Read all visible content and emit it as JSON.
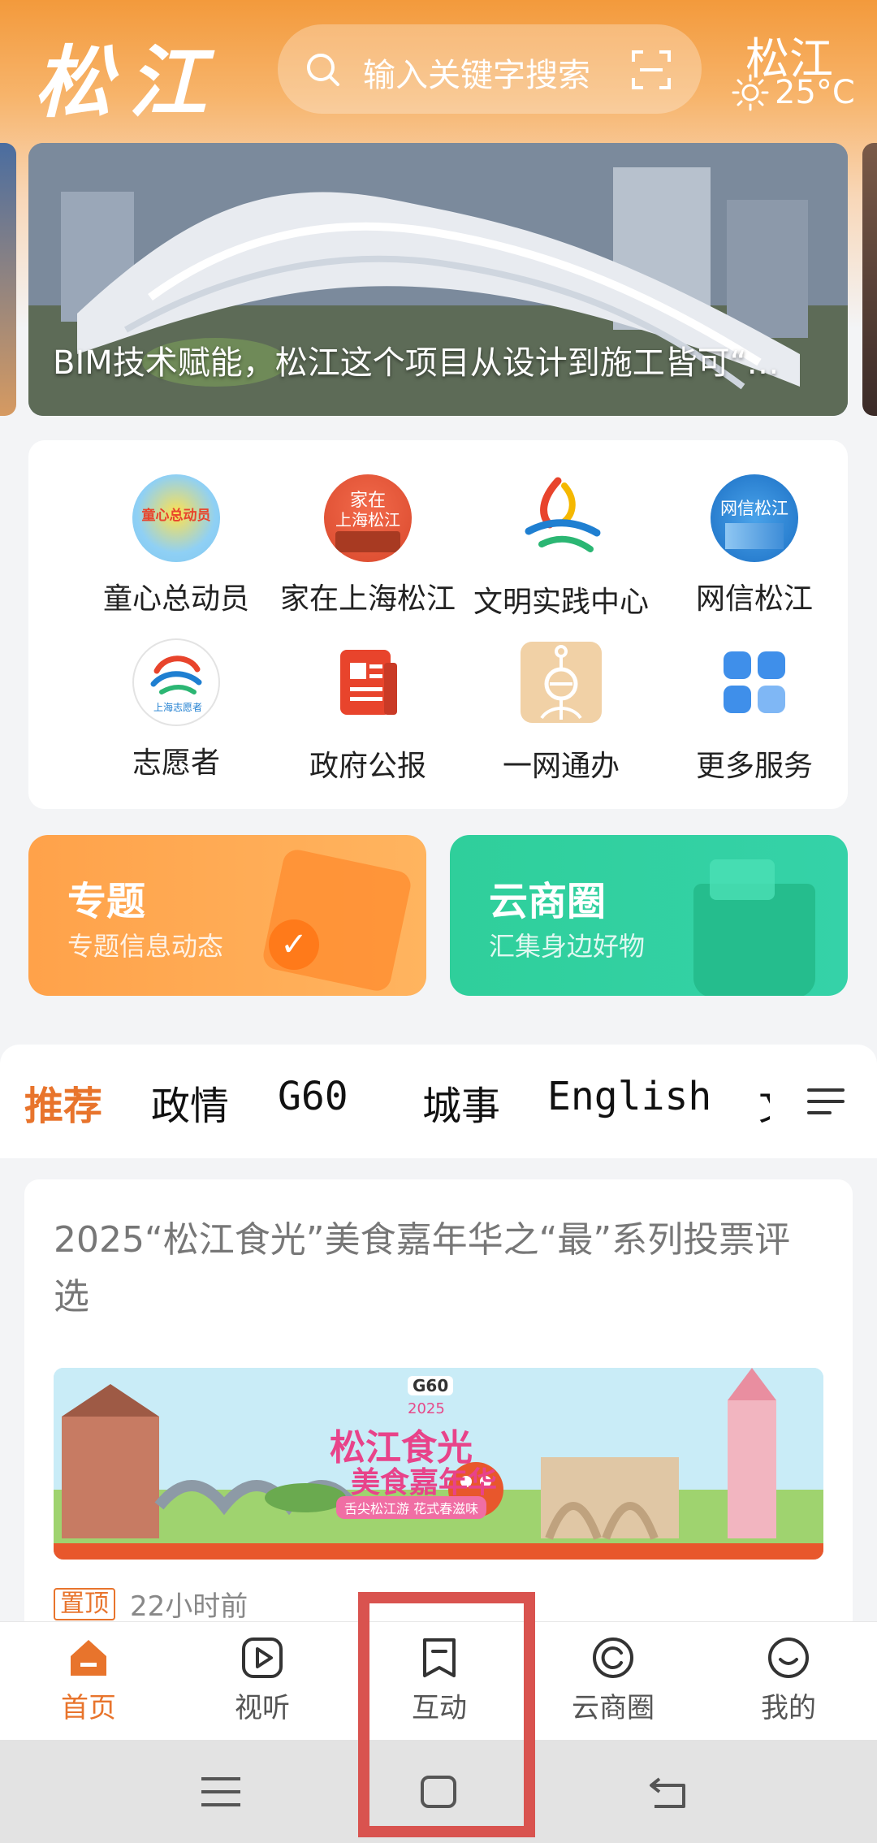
{
  "header": {
    "logo_text": "松江",
    "search_placeholder": "输入关键字搜索",
    "city": "松江",
    "temperature": "25°C"
  },
  "banner": {
    "caption": "BIM技术赋能，松江这个项目从设计到施工皆可“…"
  },
  "services": [
    {
      "label": "童心总动员",
      "icon": "kids-badge-icon"
    },
    {
      "label": "家在上海松江",
      "icon": "home-songjiang-icon"
    },
    {
      "label": "文明实践中心",
      "icon": "civilization-center-icon"
    },
    {
      "label": "网信松江",
      "icon": "net-info-icon"
    },
    {
      "label": "志愿者",
      "icon": "volunteer-icon"
    },
    {
      "label": "政府公报",
      "icon": "gazette-icon"
    },
    {
      "label": "一网通办",
      "icon": "one-network-icon"
    },
    {
      "label": "更多服务",
      "icon": "more-grid-icon"
    }
  ],
  "service_icon_text": {
    "kids": "童心总动员",
    "home_line1": "家在",
    "home_line2": "上海松江",
    "netinfo": "网信松江",
    "volunteer": "上海志愿者"
  },
  "promos": [
    {
      "title": "专题",
      "subtitle": "专题信息动态"
    },
    {
      "title": "云商圈",
      "subtitle": "汇集身边好物"
    }
  ],
  "tabs": [
    "推荐",
    "政情",
    "G60",
    "城事",
    "English",
    "文"
  ],
  "news": {
    "title": "2025“松江食光”美食嘉年华之“最”系列投票评选",
    "image_logo": "G60",
    "image_text1": "松江食光",
    "image_text2": "美食嘉年华",
    "image_year": "2025",
    "image_sub": "舌尖松江游 花式春滋味",
    "pin_label": "置顶",
    "time": "22小时前"
  },
  "bottom_nav": [
    {
      "label": "首页",
      "icon": "home-icon",
      "active": true
    },
    {
      "label": "视听",
      "icon": "play-icon",
      "active": false
    },
    {
      "label": "互动",
      "icon": "bookmark-icon",
      "active": false
    },
    {
      "label": "云商圈",
      "icon": "cloud-shop-icon",
      "active": false
    },
    {
      "label": "我的",
      "icon": "profile-icon",
      "active": false
    }
  ],
  "colors": {
    "accent": "#e8742c",
    "header_orange": "#f39a3c",
    "promo_orange": "#ffa24a",
    "promo_green": "#2fcf9b",
    "highlight": "#d9534f"
  }
}
